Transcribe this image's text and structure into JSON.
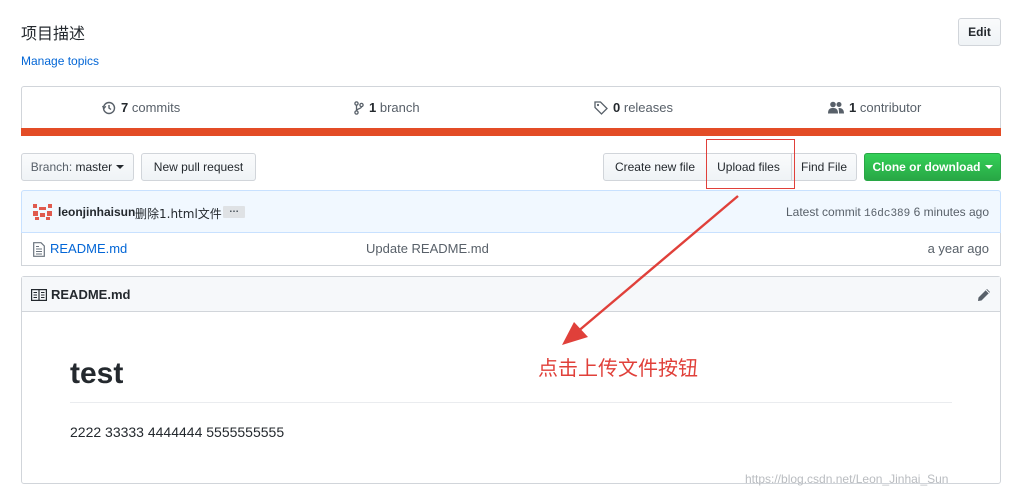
{
  "repo": {
    "description": "项目描述",
    "manage_topics": "Manage topics",
    "edit_label": "Edit"
  },
  "summary": {
    "commits_count": "7",
    "commits_label": "commits",
    "branch_count": "1",
    "branch_label": "branch",
    "releases_count": "0",
    "releases_label": "releases",
    "contributor_count": "1",
    "contributor_label": "contributor",
    "language_color": "#e34c26"
  },
  "toolbar": {
    "branch_prefix": "Branch:",
    "branch_name": "master",
    "new_pull_request": "New pull request",
    "create_new_file": "Create new file",
    "upload_files": "Upload files",
    "find_file": "Find File",
    "clone_or_download": "Clone or download"
  },
  "commit": {
    "author": "leonjinhaisun",
    "message": "删除1.html文件",
    "ellipsis": "…",
    "latest_label": "Latest commit",
    "sha": "16dc389",
    "age": "6 minutes ago"
  },
  "files": [
    {
      "name": "README.md",
      "message": "Update README.md",
      "age": "a year ago",
      "icon": "file-icon"
    }
  ],
  "readme": {
    "title": "README.md",
    "heading": "test",
    "body": "2222 33333 4444444 5555555555"
  },
  "annotation": {
    "text": "点击上传文件按钮",
    "color": "#e0403a"
  },
  "watermark": "https://blog.csdn.net/Leon_Jinhai_Sun"
}
